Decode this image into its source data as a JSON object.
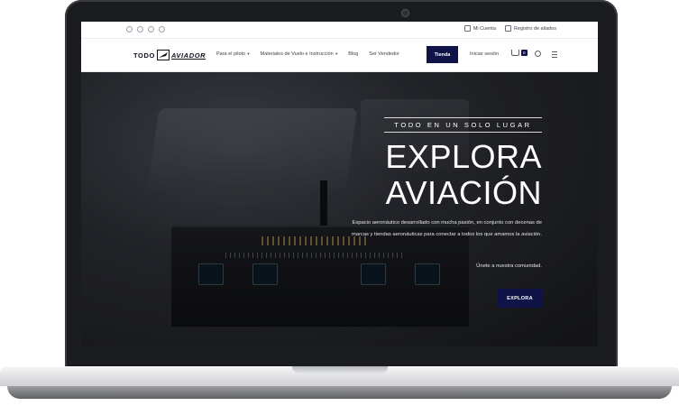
{
  "topbar": {
    "social_icons": [
      "facebook-icon",
      "instagram-icon",
      "linkedin-icon",
      "tiktok-icon"
    ],
    "my_account": "Mi Cuenta",
    "register": "Registro de aliados"
  },
  "nav": {
    "logo_part1": "TODO",
    "logo_part2": "AVIADOR",
    "items": [
      {
        "label": "Para el piloto",
        "has_dropdown": true
      },
      {
        "label": "Materiales de Vuelo e Instrucción",
        "has_dropdown": true
      },
      {
        "label": "Blog",
        "has_dropdown": false
      },
      {
        "label": "Ser Vendedor",
        "has_dropdown": false
      }
    ],
    "shop_button": "Tienda",
    "login": "Iniciar sesión",
    "cart_count": "0"
  },
  "hero": {
    "tagline": "TODO EN UN SOLO LUGAR",
    "title_line1": "EXPLORA",
    "title_line2": "AVIACIÓN",
    "description": "Espacio aeronáutico desarrollado con mucha pasión, en conjunto con decenas de marcas y tiendas aeronáuticas para conectar a todos los que amamos la aviación.",
    "join_text": "Únete a nuestra comunidad.",
    "cta_button": "EXPLORA"
  },
  "colors": {
    "brand_navy": "#0f1347",
    "laptop_bezel": "#1b1c20"
  }
}
